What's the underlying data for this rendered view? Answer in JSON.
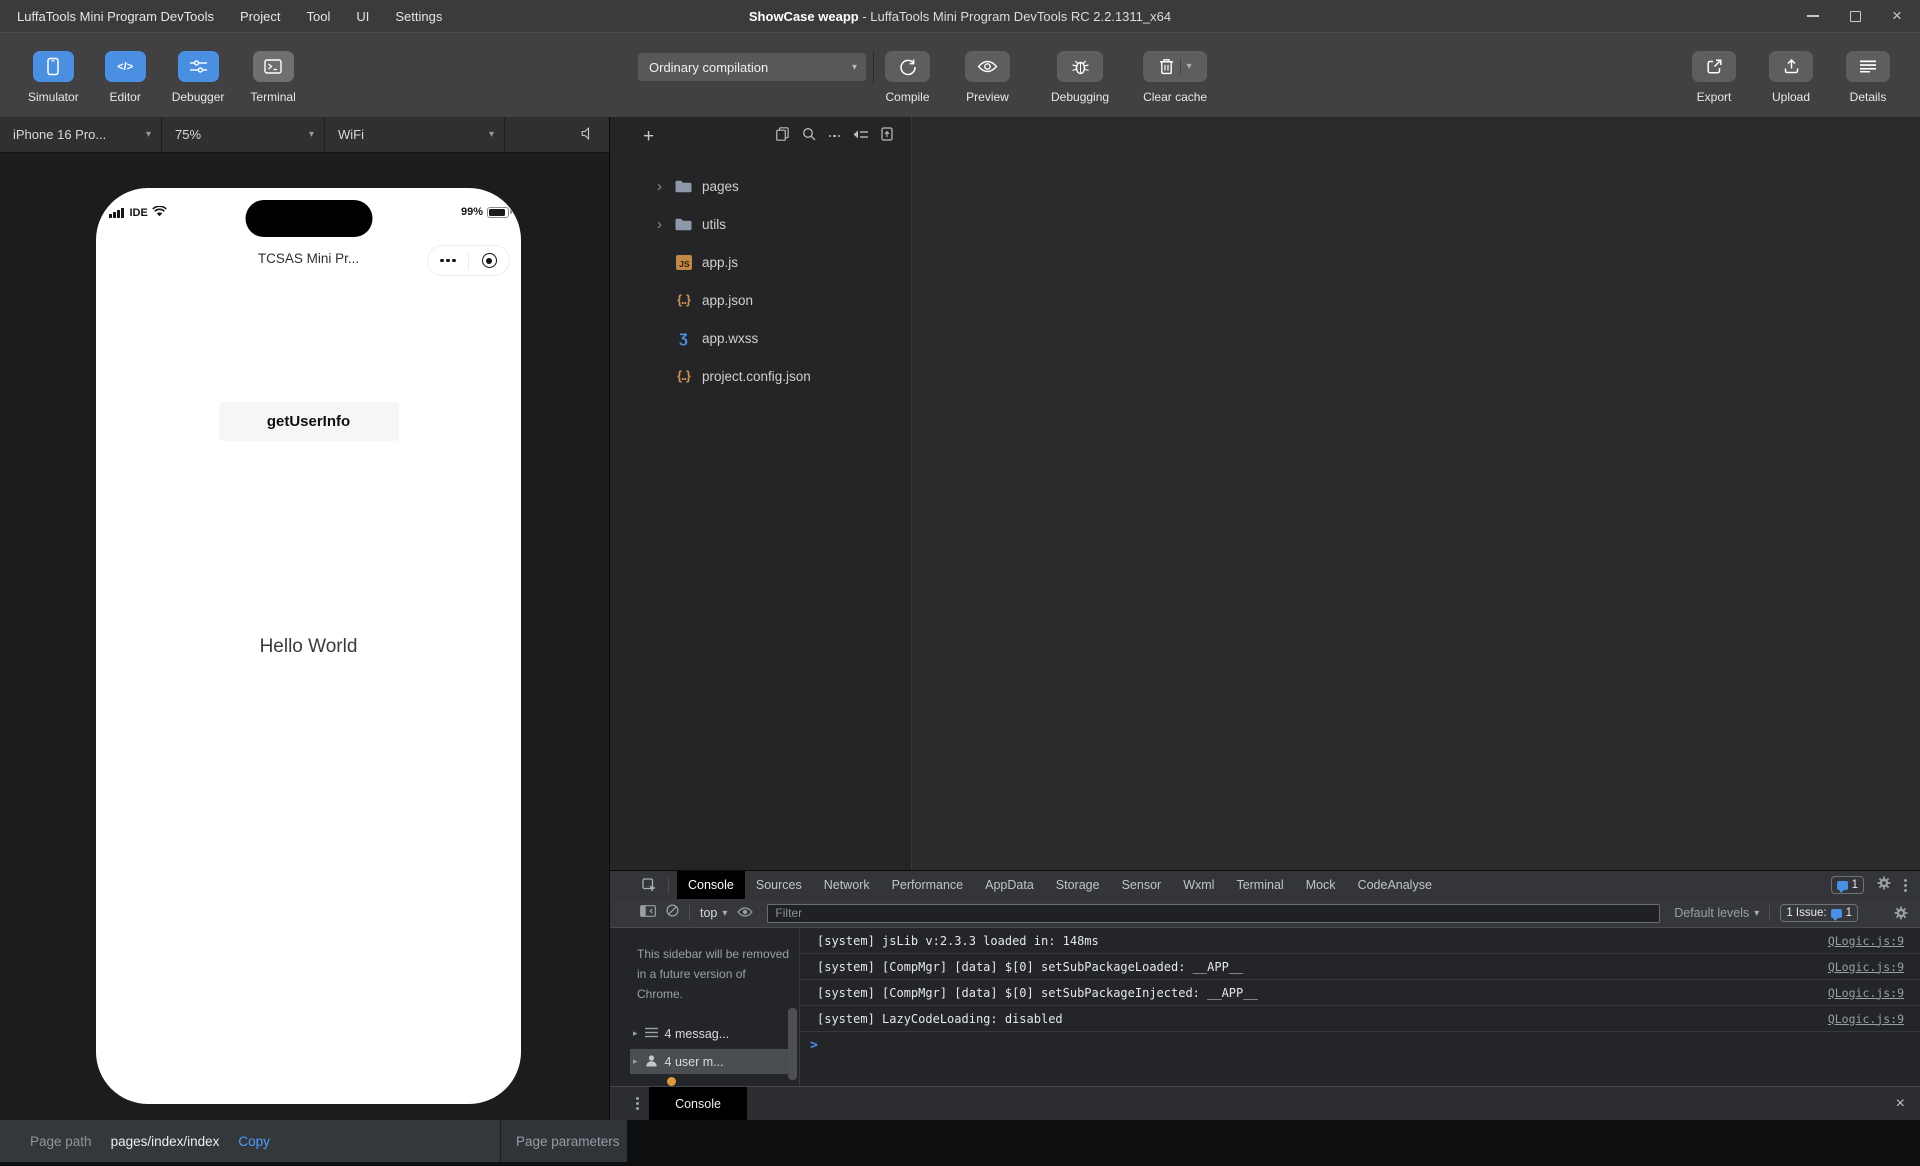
{
  "icons": {
    "caret_down": "▾",
    "tree_chevron": "›",
    "row_triangle": "▸",
    "close": "×",
    "plus": "+",
    "code_glyph": "</>",
    "js_glyph": "JS",
    "json_braces": "{..}",
    "wxss_glyph": "ʒ",
    "prompt": ">"
  },
  "menubar": {
    "app_name": "LuffaTools Mini Program DevTools",
    "items": [
      "Project",
      "Tool",
      "UI",
      "Settings"
    ],
    "window_title_project": "ShowCase weapp",
    "window_title_rest": " - LuffaTools Mini Program DevTools RC 2.2.1311_x64"
  },
  "toolbar": {
    "apps": [
      {
        "label": "Simulator"
      },
      {
        "label": "Editor"
      },
      {
        "label": "Debugger"
      },
      {
        "label": "Terminal"
      }
    ],
    "compile_mode": "Ordinary compilation",
    "actions": [
      {
        "label": "Compile"
      },
      {
        "label": "Preview"
      },
      {
        "label": "Debugging"
      },
      {
        "label": "Clear cache"
      }
    ],
    "right_actions": [
      {
        "label": "Export"
      },
      {
        "label": "Upload"
      },
      {
        "label": "Details"
      }
    ]
  },
  "device_bar": {
    "device": "iPhone 16 Pro...",
    "zoom": "75%",
    "network": "WiFi"
  },
  "simulator": {
    "carrier": "IDE",
    "battery": "99%",
    "nav_title": "TCSAS Mini Pr...",
    "primary_button": "getUserInfo",
    "body_text": "Hello World"
  },
  "file_tree": {
    "items": [
      {
        "name": "pages",
        "type": "folder"
      },
      {
        "name": "utils",
        "type": "folder"
      },
      {
        "name": "app.js",
        "type": "js"
      },
      {
        "name": "app.json",
        "type": "json"
      },
      {
        "name": "app.wxss",
        "type": "wxss"
      },
      {
        "name": "project.config.json",
        "type": "json"
      }
    ]
  },
  "devtools": {
    "tabs": [
      "Console",
      "Sources",
      "Network",
      "Performance",
      "AppData",
      "Storage",
      "Sensor",
      "Wxml",
      "Terminal",
      "Mock",
      "CodeAnalyse"
    ],
    "active_tab": "Console",
    "tab_badge_count": "1",
    "toolbar": {
      "context": "top",
      "filter_placeholder": "Filter",
      "levels_label": "Default levels",
      "issue_label": "1 Issue:",
      "issue_count": "1"
    },
    "sidebar": {
      "notice": "This sidebar will be removed in a future version of Chrome.",
      "groups": [
        {
          "label": "4 messag..."
        },
        {
          "label": "4 user m..."
        }
      ]
    },
    "messages": [
      {
        "text": "[system] jsLib v:2.3.3 loaded in: 148ms",
        "source": "QLogic.js:9"
      },
      {
        "text": "[system] [CompMgr] [data] $[0] setSubPackageLoaded: __APP__",
        "source": "QLogic.js:9"
      },
      {
        "text": "[system] [CompMgr] [data] $[0] setSubPackageInjected: __APP__",
        "source": "QLogic.js:9"
      },
      {
        "text": "[system] LazyCodeLoading: disabled",
        "source": "QLogic.js:9"
      }
    ],
    "drawer_tab": "Console"
  },
  "statusbar": {
    "path_label": "Page path",
    "path_value": "pages/index/index",
    "copy_label": "Copy",
    "params_label": "Page parameters"
  }
}
